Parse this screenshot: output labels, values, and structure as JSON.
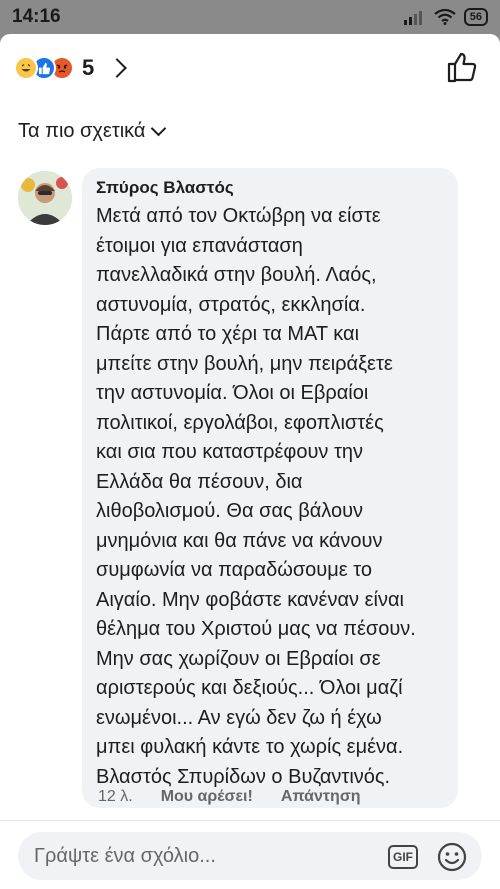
{
  "status_bar": {
    "time": "14:16",
    "battery": "56"
  },
  "reactions": {
    "count": "5",
    "icons": [
      "haha-icon",
      "like-icon",
      "angry-icon"
    ],
    "colors": {
      "haha": "#f7c64b",
      "like": "#1b74e4",
      "angry": "#e4582a"
    }
  },
  "sort": {
    "label": "Τα πιο σχετικά"
  },
  "comment": {
    "author": "Σπύρος Βλαστός",
    "text": "Μετά από τον Οκτώβρη να είστε\nέτοιμοι για επανάσταση\nπανελλαδικά στην βουλή. Λαός,\nαστυνομία, στρατός, εκκλησία.\nΠάρτε από το χέρι τα ΜΑΤ και\nμπείτε στην βουλή, μην πειράξετε\nτην αστυνομία. Όλοι οι Εβραίοι\nπολιτικοί, εργολάβοι, εφοπλιστές\nκαι σια που καταστρέφουν την\nΕλλάδα θα πέσουν, δια\nλιθοβολισμού. Θα σας βάλουν\nμνημόνια και θα πάνε να κάνουν\nσυμφωνία να παραδώσουμε το\nΑιγαίο. Μην φοβάστε κανέναν είναι\nθέλημα του Χριστού μας να πέσουν.\nΜην σας χωρίζουν οι Εβραίοι σε\nαριστερούς και δεξιούς... Όλοι μαζί\nενωμένοι... Αν εγώ δεν ζω ή έχω\nμπει φυλακή κάντε το χωρίς εμένα.\nΒλαστός Σπυρίδων ο Βυζαντινός.",
    "time": "12 λ.",
    "like_label": "Μου αρέσει!",
    "reply_label": "Απάντηση"
  },
  "composer": {
    "placeholder": "Γράψτε ένα σχόλιο...",
    "gif_label": "GIF"
  }
}
